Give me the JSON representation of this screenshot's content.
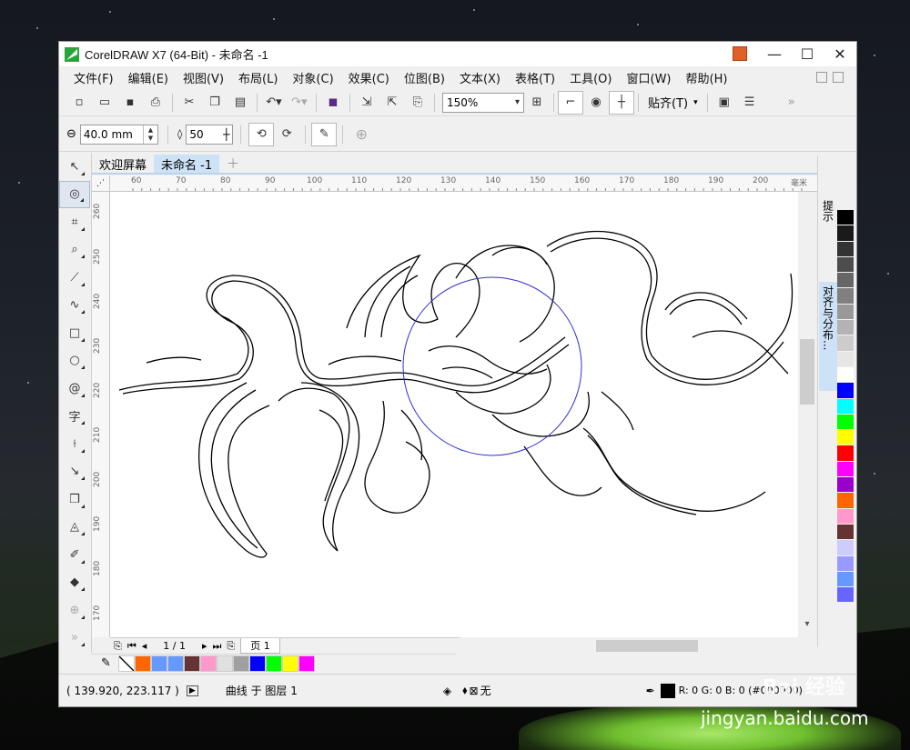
{
  "window": {
    "title": "CorelDRAW X7 (64-Bit) - 未命名 -1"
  },
  "menu": [
    "文件(F)",
    "编辑(E)",
    "视图(V)",
    "布局(L)",
    "对象(C)",
    "效果(C)",
    "位图(B)",
    "文本(X)",
    "表格(T)",
    "工具(O)",
    "窗口(W)",
    "帮助(H)"
  ],
  "toolbar": {
    "zoom_value": "150%",
    "snap_label": "贴齐(T)"
  },
  "propbar": {
    "width_value": "40.0 mm",
    "steps_value": "50"
  },
  "doc_tabs": [
    "欢迎屏幕",
    "未命名 -1"
  ],
  "ruler": {
    "unit": "毫米",
    "h_labels": [
      "60",
      "70",
      "80",
      "90",
      "100",
      "110",
      "120",
      "130",
      "140",
      "150",
      "160",
      "170",
      "180",
      "190",
      "200"
    ],
    "v_labels": [
      "260",
      "250",
      "240",
      "230",
      "220",
      "210",
      "200",
      "190",
      "180",
      "170"
    ]
  },
  "page_nav": {
    "counter": "1 / 1",
    "page_tab": "页 1"
  },
  "dockers": {
    "hints": "提示",
    "align": "对齐与分布..."
  },
  "status": {
    "coords": "( 139.920, 223.117 )",
    "object_info": "曲线 于 图层 1",
    "fill_label": "无",
    "outline_color": "R: 0 G: 0 B: 0 (#000000)"
  },
  "palette": [
    "#000000",
    "#1a1a1a",
    "#333333",
    "#4d4d4d",
    "#666666",
    "#808080",
    "#999999",
    "#b3b3b3",
    "#cccccc",
    "#e6e6e6",
    "#ffffff",
    "#0000ff",
    "#00ffff",
    "#00ff00",
    "#ffff00",
    "#ff0000",
    "#ff00ff",
    "#9900cc",
    "#ff6600",
    "#ff99cc",
    "#663333",
    "#ccccff",
    "#9999ff",
    "#6699ff",
    "#6666ff"
  ],
  "doc_palette": [
    "#ff6600",
    "#6699ff",
    "#6699ff",
    "#663333",
    "#ff99cc",
    "#e0e0e0",
    "#a0a0a0",
    "#0000ff",
    "#00ff00",
    "#ffff00",
    "#ff00ff"
  ],
  "watermark": {
    "site": "jingyan.baidu.com",
    "logo": "Bai 经验"
  }
}
